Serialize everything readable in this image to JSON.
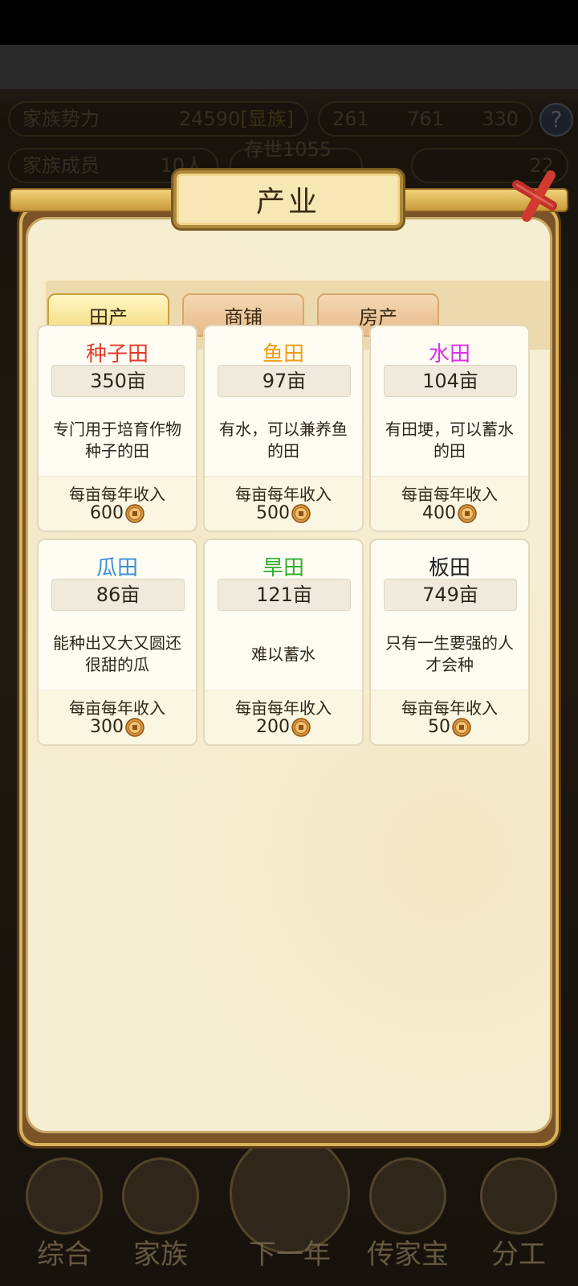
{
  "background": {
    "stats": {
      "clan_power_label": "家族势力",
      "clan_power_value": "24590",
      "clan_rank_label": "[显族]",
      "gold_bars": "261",
      "silver_bars": "761",
      "extra_value": "330",
      "members_label": "家族成员",
      "members_value": "10人",
      "exist_label": "存世1055年",
      "ingot_value": "22"
    },
    "bottom_nav": [
      {
        "label": "综合"
      },
      {
        "label": "家族"
      },
      {
        "label": "下一年"
      },
      {
        "label": "传家宝"
      },
      {
        "label": "分工"
      }
    ]
  },
  "modal": {
    "title": "产业",
    "tabs": [
      {
        "label": "田产",
        "active": true
      },
      {
        "label": "商铺",
        "active": false
      },
      {
        "label": "房产",
        "active": false
      }
    ],
    "income_label": "每亩每年收入",
    "fields": [
      {
        "name": "种子田",
        "color": "#e23b2e",
        "area": "350亩",
        "description": "专门用于培育作物种子的田",
        "income": "600"
      },
      {
        "name": "鱼田",
        "color": "#f39c12",
        "area": "97亩",
        "description": "有水，可以兼养鱼的田",
        "income": "500"
      },
      {
        "name": "水田",
        "color": "#d930e8",
        "area": "104亩",
        "description": "有田埂，可以蓄水的田",
        "income": "400"
      },
      {
        "name": "瓜田",
        "color": "#3a8fd9",
        "area": "86亩",
        "description": "能种出又大又圆还很甜的瓜",
        "income": "300"
      },
      {
        "name": "旱田",
        "color": "#2fae2f",
        "area": "121亩",
        "description": "难以蓄水",
        "income": "200"
      },
      {
        "name": "板田",
        "color": "#222222",
        "area": "749亩",
        "description": "只有一生要强的人才会种",
        "income": "50"
      }
    ]
  }
}
